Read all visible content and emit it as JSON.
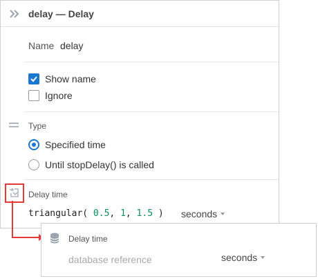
{
  "panel": {
    "title": "delay — Delay",
    "name_label": "Name",
    "name_value": "delay",
    "show_name": {
      "label": "Show name",
      "checked": true
    },
    "ignore": {
      "label": "Ignore",
      "checked": false
    },
    "type_label": "Type",
    "type_options": [
      {
        "label": "Specified time",
        "selected": true
      },
      {
        "label": "Until stopDelay() is called",
        "selected": false
      }
    ],
    "delay_time_label": "Delay time",
    "delay_code": {
      "fn": "triangular(",
      "a": "0.5",
      "b": "1",
      "c": "1.5",
      "close": ")"
    },
    "delay_units": "seconds"
  },
  "popup": {
    "title": "Delay time",
    "placeholder": "database reference",
    "units": "seconds"
  },
  "colors": {
    "accent": "#1976d2",
    "highlight": "#e53935",
    "number": "#0a8f5a"
  },
  "icons": [
    "collapse-icon",
    "drag-handle-icon",
    "switch-to-database-icon",
    "database-icon",
    "chevron-down-icon"
  ]
}
